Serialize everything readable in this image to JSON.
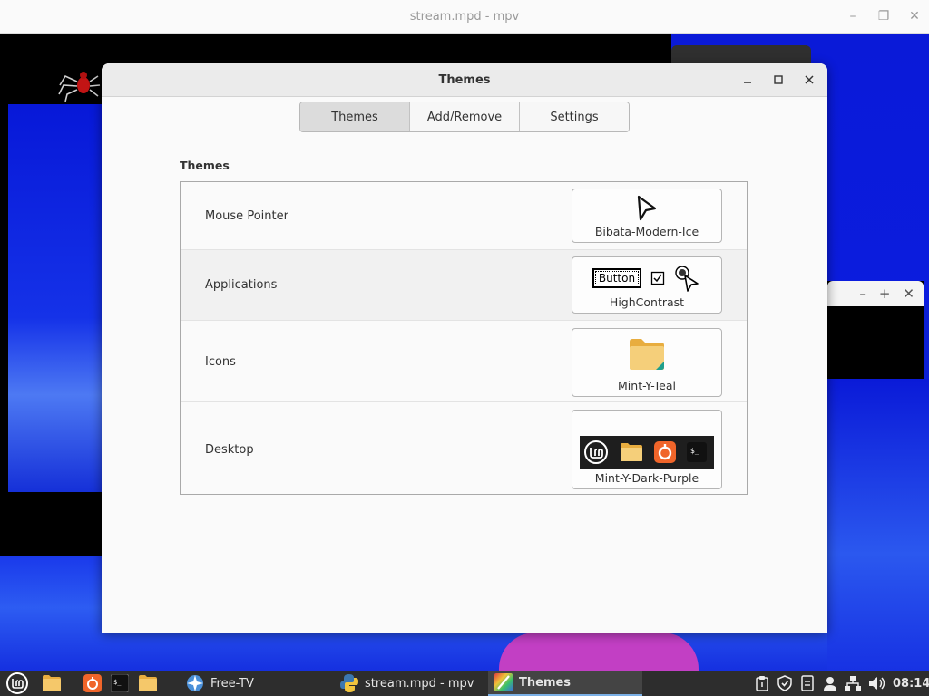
{
  "mpv_window": {
    "title": "stream.mpd - mpv"
  },
  "themes_window": {
    "title": "Themes",
    "tabs": [
      {
        "label": "Themes",
        "active": true
      },
      {
        "label": "Add/Remove",
        "active": false
      },
      {
        "label": "Settings",
        "active": false
      }
    ],
    "section_title": "Themes",
    "rows": [
      {
        "label": "Mouse Pointer",
        "value": "Bibata-Modern-Ice"
      },
      {
        "label": "Applications",
        "value": "HighContrast",
        "preview_button": "Button"
      },
      {
        "label": "Icons",
        "value": "Mint-Y-Teal"
      },
      {
        "label": "Desktop",
        "value": "Mint-Y-Dark-Purple"
      }
    ]
  },
  "taskbar": {
    "apps": [
      {
        "label": "Free-TV",
        "icon": "free-tv-icon"
      },
      {
        "label": "stream.mpd - mpv",
        "icon": "python-icon"
      },
      {
        "label": "Themes",
        "icon": "themes-icon",
        "active": true
      }
    ],
    "clock": "08:14"
  },
  "colors": {
    "taskbar_bg": "#2d2d2d",
    "window_bg": "#fafafa",
    "tab_active": "#dcdcdc",
    "folder_yellow": "#f2c35c",
    "desktop_preview_bg": "#1e1e1e",
    "firefox_orange": "#f0652a"
  }
}
